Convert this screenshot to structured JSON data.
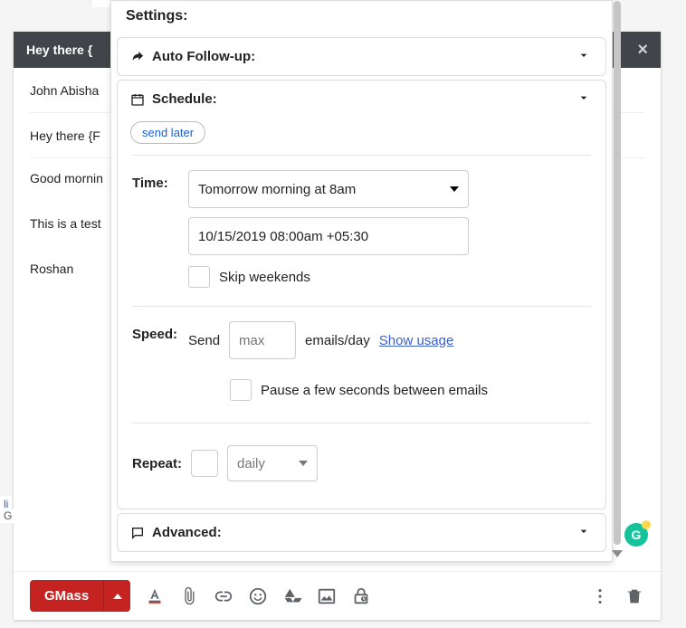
{
  "compose": {
    "subject": "Hey there {",
    "to_line": "John Abisha",
    "subject_line": "Hey there {F",
    "body_line1": "Good mornin",
    "body_line2": "This is a test",
    "body_line3": "Roshan"
  },
  "settings": {
    "title": "Settings:",
    "auto_followup": {
      "label": "Auto Follow-up:"
    },
    "schedule": {
      "label": "Schedule:",
      "pill": "send later",
      "time_label": "Time:",
      "time_select": "Tomorrow morning at 8am",
      "datetime": "10/15/2019 08:00am +05:30",
      "skip_weekends": "Skip weekends"
    },
    "speed": {
      "label": "Speed:",
      "send": "Send",
      "max_placeholder": "max",
      "per_day": "emails/day",
      "show_usage": "Show usage",
      "pause": "Pause a few seconds between emails"
    },
    "repeat": {
      "label": "Repeat:",
      "unit": "daily"
    },
    "advanced": {
      "label": "Advanced:"
    }
  },
  "toolbar": {
    "gmass": "GMass"
  },
  "fragments": {
    "left1": "li",
    "left2": "G"
  }
}
